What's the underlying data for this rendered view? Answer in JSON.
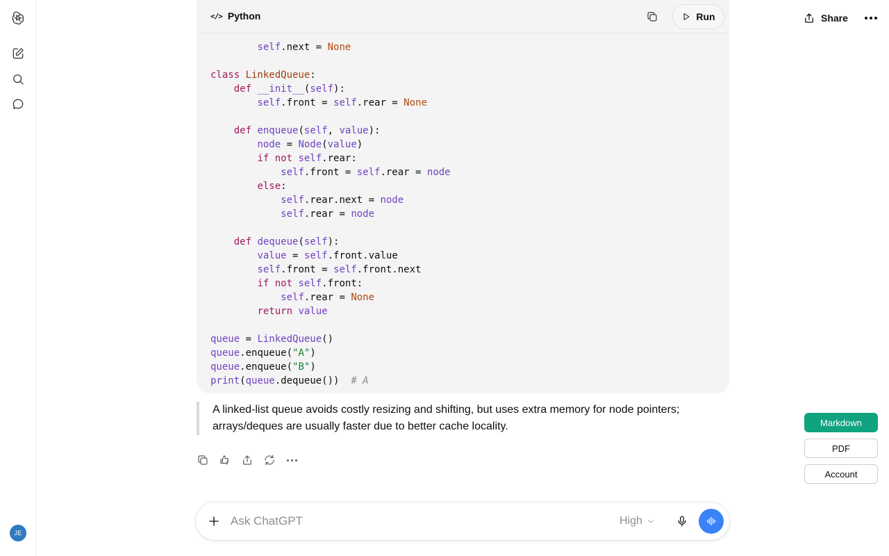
{
  "sidebar": {
    "avatar_initials": "JE"
  },
  "header": {
    "share_label": "Share"
  },
  "code_block": {
    "language": "Python",
    "language_icon": "</>",
    "run_label": "Run"
  },
  "code_lines": [
    [
      [
        "",
        "        "
      ],
      [
        "self",
        "self"
      ],
      [
        "",
        ".next "
      ],
      [
        "",
        "= "
      ],
      [
        "none",
        "None"
      ]
    ],
    [
      [
        "",
        ""
      ]
    ],
    [
      [
        "kw",
        "class "
      ],
      [
        "cls",
        "LinkedQueue"
      ],
      [
        "",
        ":"
      ]
    ],
    [
      [
        "",
        "    "
      ],
      [
        "kw",
        "def "
      ],
      [
        "var",
        "__init__"
      ],
      [
        "",
        "("
      ],
      [
        "self",
        "self"
      ],
      [
        "",
        "):"
      ]
    ],
    [
      [
        "",
        "        "
      ],
      [
        "self",
        "self"
      ],
      [
        "",
        ".front = "
      ],
      [
        "self",
        "self"
      ],
      [
        "",
        ".rear = "
      ],
      [
        "none",
        "None"
      ]
    ],
    [
      [
        "",
        ""
      ]
    ],
    [
      [
        "",
        "    "
      ],
      [
        "kw",
        "def "
      ],
      [
        "var",
        "enqueue"
      ],
      [
        "",
        "("
      ],
      [
        "self",
        "self"
      ],
      [
        "",
        ", "
      ],
      [
        "var",
        "value"
      ],
      [
        "",
        "):"
      ]
    ],
    [
      [
        "",
        "        "
      ],
      [
        "var",
        "node"
      ],
      [
        "",
        " = "
      ],
      [
        "var",
        "Node"
      ],
      [
        "",
        "("
      ],
      [
        "var",
        "value"
      ],
      [
        "",
        ")"
      ]
    ],
    [
      [
        "",
        "        "
      ],
      [
        "kw",
        "if not "
      ],
      [
        "self",
        "self"
      ],
      [
        "",
        ".rear:"
      ]
    ],
    [
      [
        "",
        "            "
      ],
      [
        "self",
        "self"
      ],
      [
        "",
        ".front = "
      ],
      [
        "self",
        "self"
      ],
      [
        "",
        ".rear = "
      ],
      [
        "var",
        "node"
      ]
    ],
    [
      [
        "",
        "        "
      ],
      [
        "kw",
        "else"
      ],
      [
        "",
        ":"
      ]
    ],
    [
      [
        "",
        "            "
      ],
      [
        "self",
        "self"
      ],
      [
        "",
        ".rear.next = "
      ],
      [
        "var",
        "node"
      ]
    ],
    [
      [
        "",
        "            "
      ],
      [
        "self",
        "self"
      ],
      [
        "",
        ".rear = "
      ],
      [
        "var",
        "node"
      ]
    ],
    [
      [
        "",
        ""
      ]
    ],
    [
      [
        "",
        "    "
      ],
      [
        "kw",
        "def "
      ],
      [
        "var",
        "dequeue"
      ],
      [
        "",
        "("
      ],
      [
        "self",
        "self"
      ],
      [
        "",
        "):"
      ]
    ],
    [
      [
        "",
        "        "
      ],
      [
        "var",
        "value"
      ],
      [
        "",
        " = "
      ],
      [
        "self",
        "self"
      ],
      [
        "",
        ".front.value"
      ]
    ],
    [
      [
        "",
        "        "
      ],
      [
        "self",
        "self"
      ],
      [
        "",
        ".front = "
      ],
      [
        "self",
        "self"
      ],
      [
        "",
        ".front.next"
      ]
    ],
    [
      [
        "",
        "        "
      ],
      [
        "kw",
        "if not "
      ],
      [
        "self",
        "self"
      ],
      [
        "",
        ".front:"
      ]
    ],
    [
      [
        "",
        "            "
      ],
      [
        "self",
        "self"
      ],
      [
        "",
        ".rear = "
      ],
      [
        "none",
        "None"
      ]
    ],
    [
      [
        "",
        "        "
      ],
      [
        "kw",
        "return "
      ],
      [
        "var",
        "value"
      ]
    ],
    [
      [
        "",
        ""
      ]
    ],
    [
      [
        "var",
        "queue"
      ],
      [
        "",
        " = "
      ],
      [
        "var",
        "LinkedQueue"
      ],
      [
        "",
        "()"
      ]
    ],
    [
      [
        "var",
        "queue"
      ],
      [
        "",
        ".enqueue("
      ],
      [
        "str",
        "\"A\""
      ],
      [
        "",
        ")"
      ]
    ],
    [
      [
        "var",
        "queue"
      ],
      [
        "",
        ".enqueue("
      ],
      [
        "str",
        "\"B\""
      ],
      [
        "",
        ")"
      ]
    ],
    [
      [
        "var",
        "print"
      ],
      [
        "",
        "("
      ],
      [
        "var",
        "queue"
      ],
      [
        "",
        ".dequeue())  "
      ],
      [
        "com",
        "# A"
      ]
    ]
  ],
  "quote_text": "A linked-list queue avoids costly resizing and shifting, but uses extra memory for node pointers; arrays/deques are usually faster due to better cache locality.",
  "side_buttons": {
    "markdown": "Markdown",
    "pdf": "PDF",
    "account": "Account"
  },
  "composer": {
    "placeholder": "Ask ChatGPT",
    "model_level": "High"
  },
  "colors": {
    "accent_green": "#10a37f",
    "voice_blue": "#3b82f6",
    "avatar_blue": "#2f7bbf"
  }
}
